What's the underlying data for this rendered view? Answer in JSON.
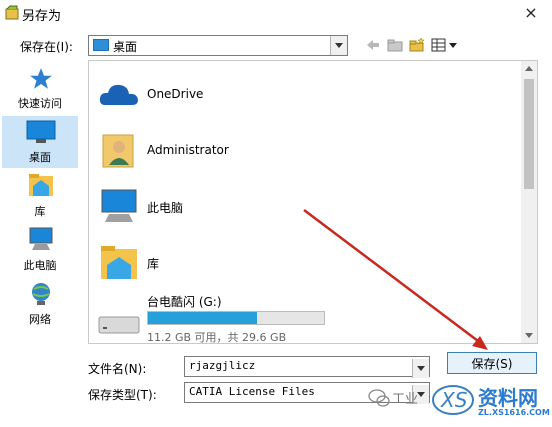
{
  "window": {
    "title": "另存为",
    "close_glyph": "×"
  },
  "toolbar": {
    "save_in_label": "保存在(I):",
    "save_in_value": "桌面",
    "icons": [
      "back-arrow-icon",
      "up-folder-icon",
      "new-folder-icon",
      "view-menu-icon"
    ]
  },
  "places": [
    {
      "label": "快速访问",
      "icon": "star-icon"
    },
    {
      "label": "桌面",
      "icon": "desktop-icon",
      "selected": true
    },
    {
      "label": "库",
      "icon": "library-icon"
    },
    {
      "label": "此电脑",
      "icon": "computer-icon"
    },
    {
      "label": "网络",
      "icon": "network-icon"
    }
  ],
  "files": [
    {
      "name": "OneDrive",
      "icon": "cloud-icon"
    },
    {
      "name": "Administrator",
      "icon": "user-folder-icon"
    },
    {
      "name": "此电脑",
      "icon": "computer-icon"
    },
    {
      "name": "库",
      "icon": "library-icon"
    }
  ],
  "drive": {
    "name": "台电酷闪 (G:)",
    "info": "11.2 GB 可用，共 29.6 GB",
    "used_fraction": 0.62
  },
  "bottom": {
    "filename_label": "文件名(N):",
    "filename_value": "rjazgjlicz",
    "filetype_label": "保存类型(T):",
    "filetype_value": "CATIA License Files",
    "save_button": "保存(S)"
  },
  "watermark": {
    "partial_text": "工业",
    "brand": "资料网",
    "url": "ZL.XS1616.COM"
  },
  "colors": {
    "accent": "#26a0da",
    "selection": "#cce4f7",
    "arrow": "#c8281e"
  }
}
